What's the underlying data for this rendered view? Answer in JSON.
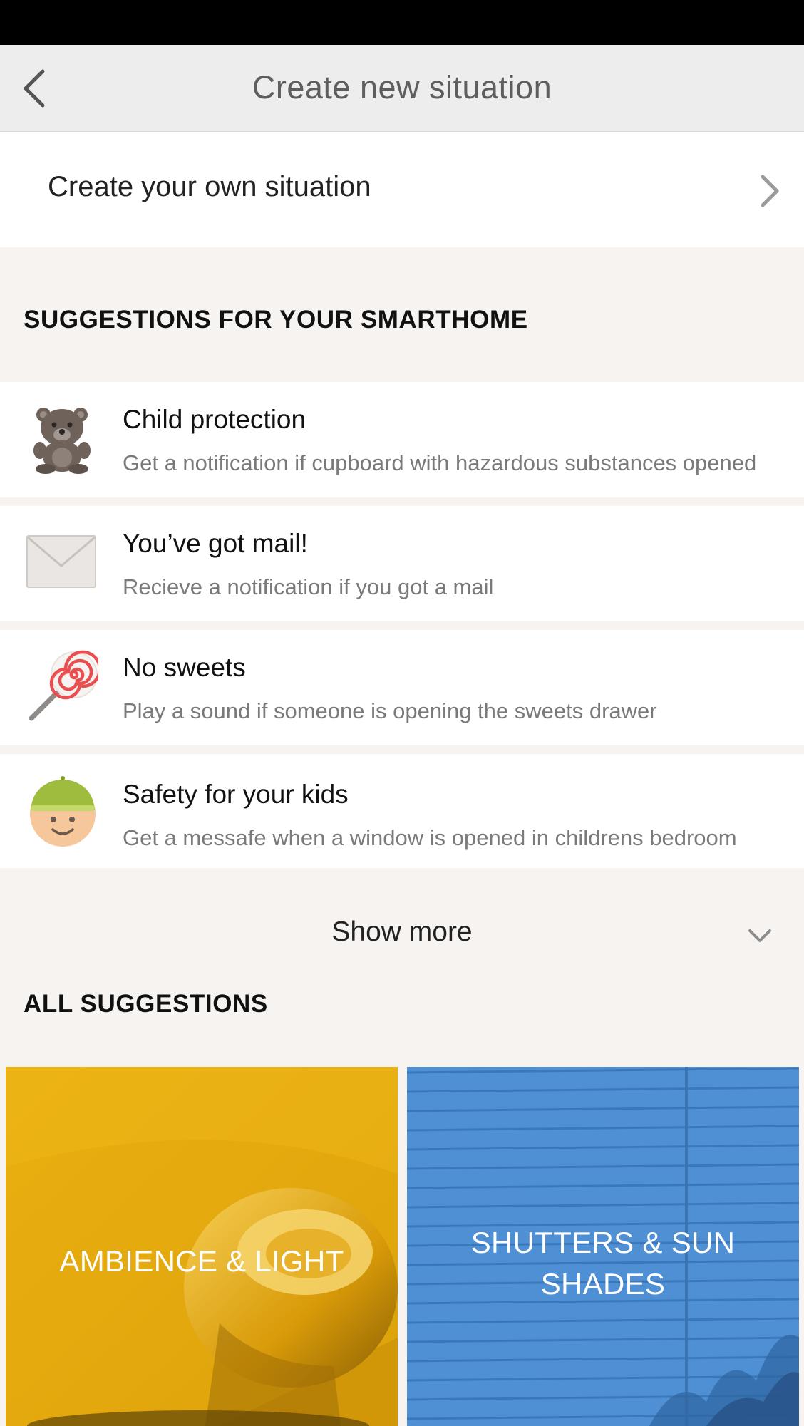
{
  "header": {
    "title": "Create new situation"
  },
  "own_situation": {
    "label": "Create your own situation"
  },
  "suggestions_section": {
    "title": "SUGGESTIONS FOR YOUR SMARTHOME",
    "items": [
      {
        "icon": "teddy-bear-icon",
        "title": "Child protection",
        "description": "Get a notification if cupboard with hazardous substances opened"
      },
      {
        "icon": "envelope-icon",
        "title": "You’ve got mail!",
        "description": "Recieve a notification if you got a mail"
      },
      {
        "icon": "lollipop-icon",
        "title": "No sweets",
        "description": "Play a sound if someone is opening the sweets drawer"
      },
      {
        "icon": "kid-face-icon",
        "title": "Safety for your kids",
        "description": "Get a messafe when a window is opened in childrens bedroom"
      }
    ],
    "show_more_label": "Show more"
  },
  "all_suggestions": {
    "title": "ALL SUGGESTIONS",
    "tiles": [
      {
        "label": "AMBIENCE & LIGHT",
        "color": "#e8ad0d"
      },
      {
        "label_line1": "SHUTTERS & SUN",
        "label_line2": "SHADES",
        "color": "#4f8fd4"
      }
    ]
  },
  "colors": {
    "nav_bg": "#ededed",
    "section_bg": "#f6f3f1",
    "secondary_text": "#7a7a7a"
  }
}
